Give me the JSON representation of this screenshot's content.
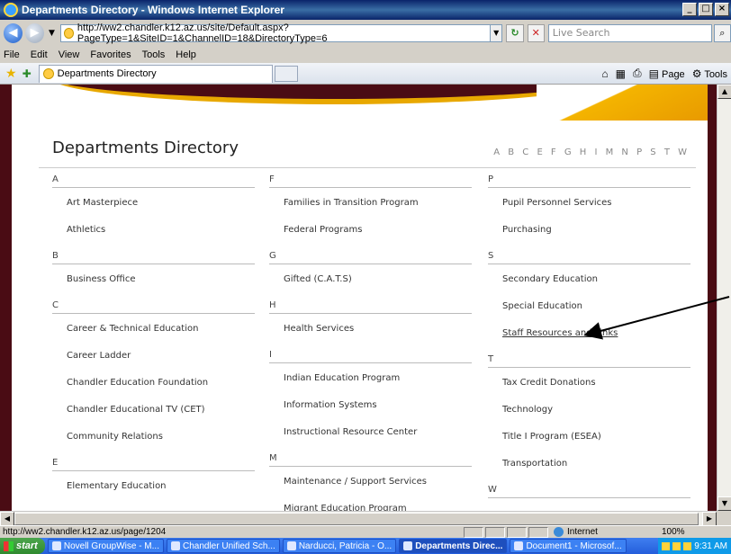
{
  "window": {
    "title": "Departments Directory - Windows Internet Explorer",
    "minimize": "_",
    "maximize": "□",
    "close": "×"
  },
  "toolbar": {
    "back": "◀",
    "forward": "▶",
    "address": "http://ww2.chandler.k12.az.us/site/Default.aspx?PageType=1&SiteID=1&ChannelID=18&DirectoryType=6",
    "search_placeholder": "Live Search",
    "refresh": "↻",
    "stop": "✕"
  },
  "menu": [
    "File",
    "Edit",
    "View",
    "Favorites",
    "Tools",
    "Help"
  ],
  "tab": {
    "label": "Departments Directory"
  },
  "command_bar": {
    "page": "Page",
    "tools": "Tools"
  },
  "page": {
    "title": "Departments Directory",
    "alphabet": "A B C E F G H I M N P S T W",
    "columns": [
      {
        "groups": [
          {
            "letter": "A",
            "items": [
              "Art Masterpiece",
              "Athletics"
            ]
          },
          {
            "letter": "B",
            "items": [
              "Business Office"
            ]
          },
          {
            "letter": "C",
            "items": [
              "Career & Technical Education",
              "Career Ladder",
              "Chandler Education Foundation",
              "Chandler Educational TV (CET)",
              "Community Relations"
            ]
          },
          {
            "letter": "E",
            "items": [
              "Elementary Education"
            ]
          }
        ]
      },
      {
        "groups": [
          {
            "letter": "F",
            "items": [
              "Families in Transition Program",
              "Federal Programs"
            ]
          },
          {
            "letter": "G",
            "items": [
              "Gifted (C.A.T.S)"
            ]
          },
          {
            "letter": "H",
            "items": [
              "Health Services"
            ]
          },
          {
            "letter": "I",
            "items": [
              "Indian Education Program",
              "Information Systems",
              "Instructional Resource Center"
            ]
          },
          {
            "letter": "M",
            "items": [
              "Maintenance / Support Services",
              "Migrant Education Program"
            ]
          }
        ]
      },
      {
        "groups": [
          {
            "letter": "P",
            "items": [
              "Pupil Personnel Services",
              "Purchasing"
            ]
          },
          {
            "letter": "S",
            "items": [
              "Secondary Education",
              "Special Education",
              "Staff Resources and Links"
            ]
          },
          {
            "letter": "T",
            "items": [
              "Tax Credit Donations",
              "Technology",
              "Title I Program (ESEA)",
              "Transportation"
            ]
          },
          {
            "letter": "W",
            "items": []
          }
        ]
      }
    ],
    "hovered_link": "Staff Resources and Links"
  },
  "status": {
    "url": "http://ww2.chandler.k12.az.us/page/1204",
    "zone": "Internet",
    "zoom": "100%"
  },
  "taskbar": {
    "start": "start",
    "tasks": [
      {
        "label": "Novell GroupWise - M...",
        "active": false
      },
      {
        "label": "Chandler Unified Sch...",
        "active": false
      },
      {
        "label": "Narducci, Patricia - O...",
        "active": false
      },
      {
        "label": "Departments Direc...",
        "active": true
      },
      {
        "label": "Document1 - Microsof...",
        "active": false
      }
    ],
    "clock": "9:31 AM"
  },
  "colors": {
    "maroon": "#4a0c14",
    "gold": "#f4b400",
    "arrow": "#000000"
  }
}
